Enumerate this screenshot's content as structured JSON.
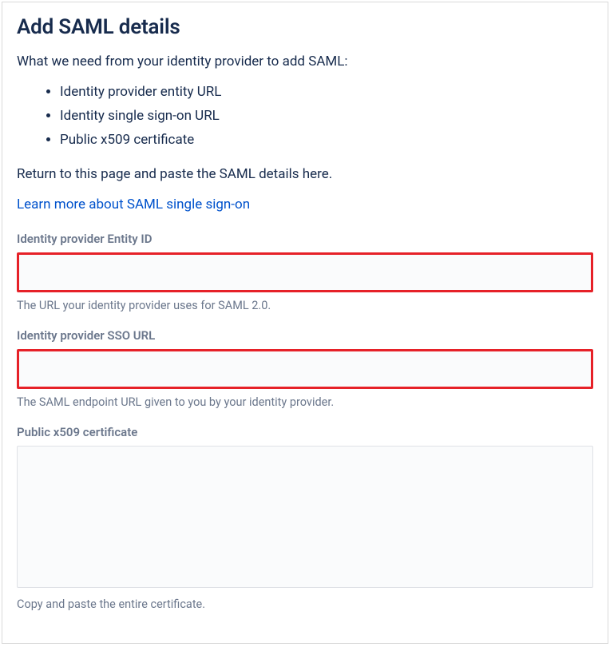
{
  "title": "Add SAML details",
  "intro": "What we need from your identity provider to add SAML:",
  "requirements": {
    "item0": "Identity provider entity URL",
    "item1": "Identity single sign-on URL",
    "item2": "Public x509 certificate"
  },
  "return_text": "Return to this page and paste the SAML details here.",
  "learn_more": "Learn more about SAML single sign-on",
  "fields": {
    "entity_id": {
      "label": "Identity provider Entity ID",
      "value": "",
      "helper": "The URL your identity provider uses for SAML 2.0."
    },
    "sso_url": {
      "label": "Identity provider SSO URL",
      "value": "",
      "helper": "The SAML endpoint URL given to you by your identity provider."
    },
    "certificate": {
      "label": "Public x509 certificate",
      "value": "",
      "helper": "Copy and paste the entire certificate."
    }
  }
}
